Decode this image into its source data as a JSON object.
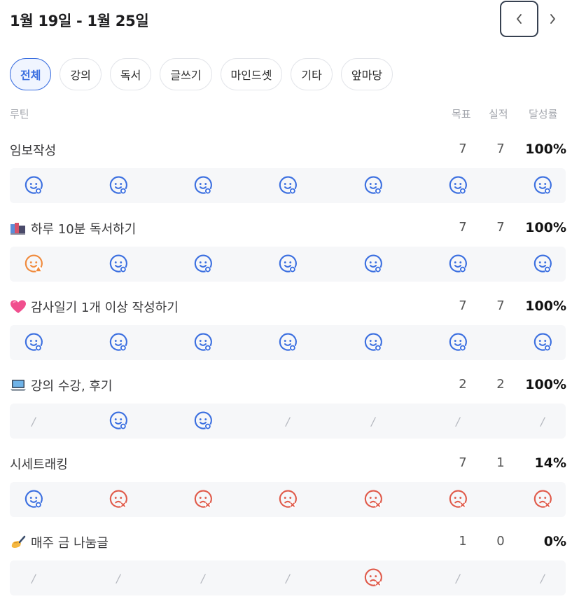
{
  "header": {
    "date_range": "1월 19일 - 1월 25일"
  },
  "filters": [
    {
      "label": "전체",
      "active": true
    },
    {
      "label": "강의",
      "active": false
    },
    {
      "label": "독서",
      "active": false
    },
    {
      "label": "글쓰기",
      "active": false
    },
    {
      "label": "마인드셋",
      "active": false
    },
    {
      "label": "기타",
      "active": false
    },
    {
      "label": "앞마당",
      "active": false
    }
  ],
  "columns": {
    "routine": "루틴",
    "goal": "목표",
    "actual": "실적",
    "rate": "달성률"
  },
  "colors": {
    "success": "#3b6fe0",
    "fail": "#e05a4a",
    "late": "#f08a3c",
    "none": "#b5b8bf"
  },
  "routines": [
    {
      "title": "임보작성",
      "emoji": "",
      "goal": "7",
      "actual": "7",
      "rate": "100%",
      "days": [
        "success",
        "success",
        "success",
        "success",
        "success",
        "success",
        "success"
      ]
    },
    {
      "title": "하루 10분 독서하기",
      "emoji": "books-icon",
      "goal": "7",
      "actual": "7",
      "rate": "100%",
      "days": [
        "late",
        "success",
        "success",
        "success",
        "success",
        "success",
        "success"
      ]
    },
    {
      "title": "감사일기 1개 이상 작성하기",
      "emoji": "heart-icon",
      "goal": "7",
      "actual": "7",
      "rate": "100%",
      "days": [
        "success",
        "success",
        "success",
        "success",
        "success",
        "success",
        "success"
      ]
    },
    {
      "title": "강의 수강, 후기",
      "emoji": "laptop-icon",
      "goal": "2",
      "actual": "2",
      "rate": "100%",
      "days": [
        "none",
        "success",
        "success",
        "none",
        "none",
        "none",
        "none"
      ]
    },
    {
      "title": "시세트래킹",
      "emoji": "",
      "goal": "7",
      "actual": "1",
      "rate": "14%",
      "days": [
        "success",
        "fail",
        "fail",
        "fail",
        "fail",
        "fail",
        "fail"
      ]
    },
    {
      "title": "매주 금 나눔글",
      "emoji": "writing-hand-icon",
      "goal": "1",
      "actual": "0",
      "rate": "0%",
      "days": [
        "none",
        "none",
        "none",
        "none",
        "fail",
        "none",
        "none"
      ]
    }
  ],
  "slash_text": "/"
}
